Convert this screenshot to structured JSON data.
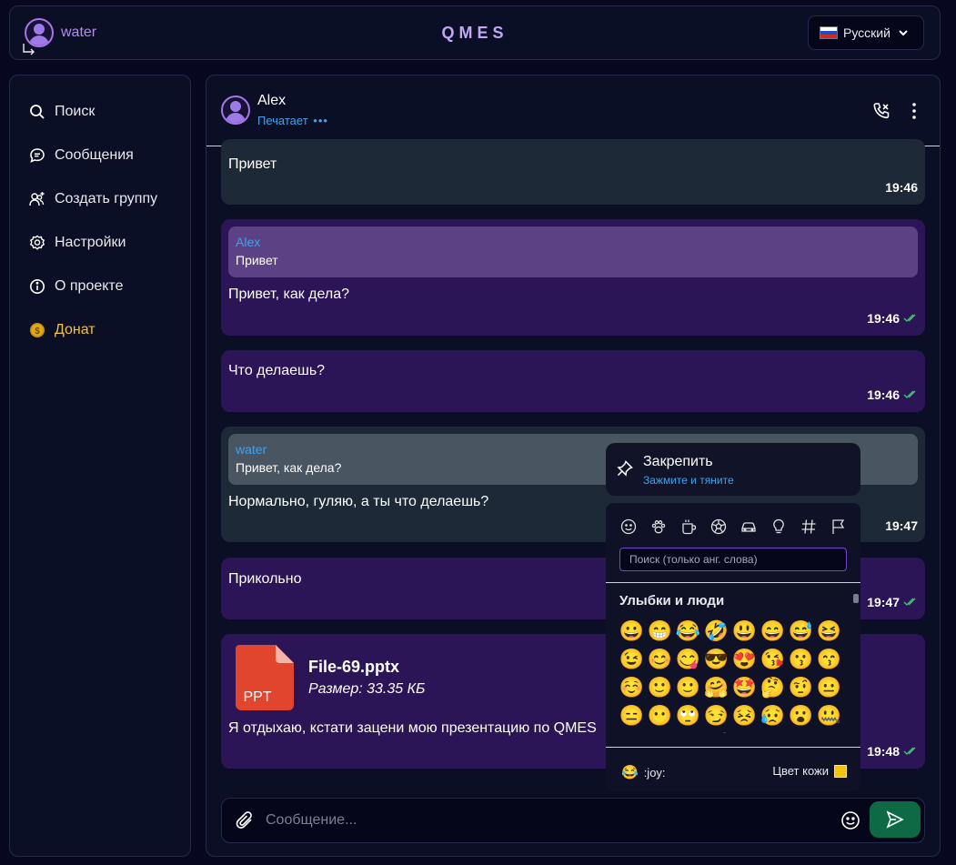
{
  "topbar": {
    "username": "water",
    "brand": "QMES",
    "language": "Русский"
  },
  "sidebar": {
    "items": [
      {
        "label": "Поиск",
        "icon": "search-icon"
      },
      {
        "label": "Сообщения",
        "icon": "chat-bubble-icon"
      },
      {
        "label": "Создать группу",
        "icon": "add-group-icon"
      },
      {
        "label": "Настройки",
        "icon": "gear-icon"
      },
      {
        "label": "О проекте",
        "icon": "info-icon"
      },
      {
        "label": "Донат",
        "icon": "coin-icon"
      }
    ]
  },
  "chat": {
    "peer_name": "Alex",
    "peer_status": "Печатает",
    "messages": [
      {
        "direction": "in",
        "text": "Привет",
        "time": "19:46"
      },
      {
        "direction": "out",
        "reply_author": "Alex",
        "reply_text": "Привет",
        "text": "Привет, как дела?",
        "time": "19:46"
      },
      {
        "direction": "out",
        "text": "Что делаешь?",
        "time": "19:46"
      },
      {
        "direction": "in",
        "reply_author": "water",
        "reply_text": "Привет, как дела?",
        "text": "Нормально, гуляю, а ты что делаешь?",
        "time": "19:47"
      },
      {
        "direction": "out",
        "text": "Прикольно",
        "time": "19:47"
      },
      {
        "direction": "out",
        "file_ext": "PPT",
        "file_name": "File-69.pptx",
        "file_size": "Размер: 33.35 КБ",
        "text": "Я отдыхаю, кстати зацени мою презентацию по QMES",
        "time": "19:48"
      }
    ],
    "composer_placeholder": "Сообщение..."
  },
  "context_menu": {
    "title": "Закрепить",
    "subtitle": "Зажмите и тяните"
  },
  "emoji_picker": {
    "search_placeholder": "Поиск (только анг. слова)",
    "category_title": "Улыбки и люди",
    "emojis": [
      "😀",
      "😁",
      "😂",
      "🤣",
      "😃",
      "😄",
      "😅",
      "😆",
      "😉",
      "😊",
      "😋",
      "😎",
      "😍",
      "😘",
      "😗",
      "😙",
      "☺️",
      "🙂",
      "🙂",
      "🤗",
      "🤩",
      "🤔",
      "🤨",
      "😐",
      "😑",
      "😶",
      "🙄",
      "😏",
      "😣",
      "😥",
      "😮",
      "🤐",
      "😯",
      "😪",
      "😫",
      "😴",
      "😌",
      "😛",
      "😜",
      "😝"
    ],
    "preview_emoji": "😂",
    "preview_code": ":joy:",
    "skin_label": "Цвет кожи",
    "skin_color": "#f1c40f"
  },
  "colors": {
    "incoming": "#1e2937",
    "outgoing": "#2c1556",
    "accent": "#a775ea",
    "link": "#3ea3ec",
    "send": "#0e6a45",
    "donate": "#f2c33c"
  }
}
